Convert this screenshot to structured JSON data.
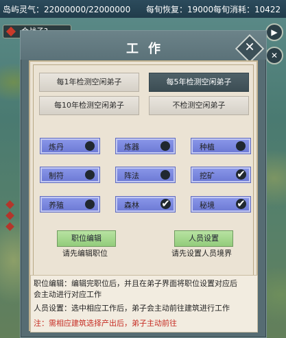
{
  "topbar": {
    "island_qi": "岛屿灵气：22000000/22000000",
    "recover": "每旬恢复：19000",
    "consume": "每旬消耗：10422"
  },
  "map_badge": "合战子?",
  "dialog": {
    "title": "工作",
    "check_options": [
      {
        "label": "每1年检测空闲弟子",
        "active": false
      },
      {
        "label": "每5年检测空闲弟子",
        "active": true
      },
      {
        "label": "每10年检测空闲弟子",
        "active": false
      },
      {
        "label": "不检测空闲弟子",
        "active": false
      }
    ],
    "jobs": [
      {
        "label": "炼丹",
        "enabled": false
      },
      {
        "label": "炼器",
        "enabled": false
      },
      {
        "label": "种植",
        "enabled": false
      },
      {
        "label": "制符",
        "enabled": false
      },
      {
        "label": "阵法",
        "enabled": false
      },
      {
        "label": "挖矿",
        "enabled": true
      },
      {
        "label": "养殖",
        "enabled": false
      },
      {
        "label": "森林",
        "enabled": true
      },
      {
        "label": "秘境",
        "enabled": true
      }
    ],
    "position_edit": {
      "button": "职位编辑",
      "hint": "请先编辑职位"
    },
    "personnel": {
      "button": "人员设置",
      "hint": "请先设置人员境界"
    },
    "description": {
      "line1": "职位编辑：编辑完职位后，并且在弟子界面将职位设置对应后",
      "line2": "会主动进行对应工作",
      "line3": "人员设置：选中相应工作后，弟子会主动前往建筑进行工作",
      "note": "注：需相应建筑选择产出后，弟子主动前往"
    }
  },
  "colors": {
    "toggle_on_bg": "#7a87e0",
    "accent_green": "#9fd488",
    "note_red": "#c62b22"
  }
}
